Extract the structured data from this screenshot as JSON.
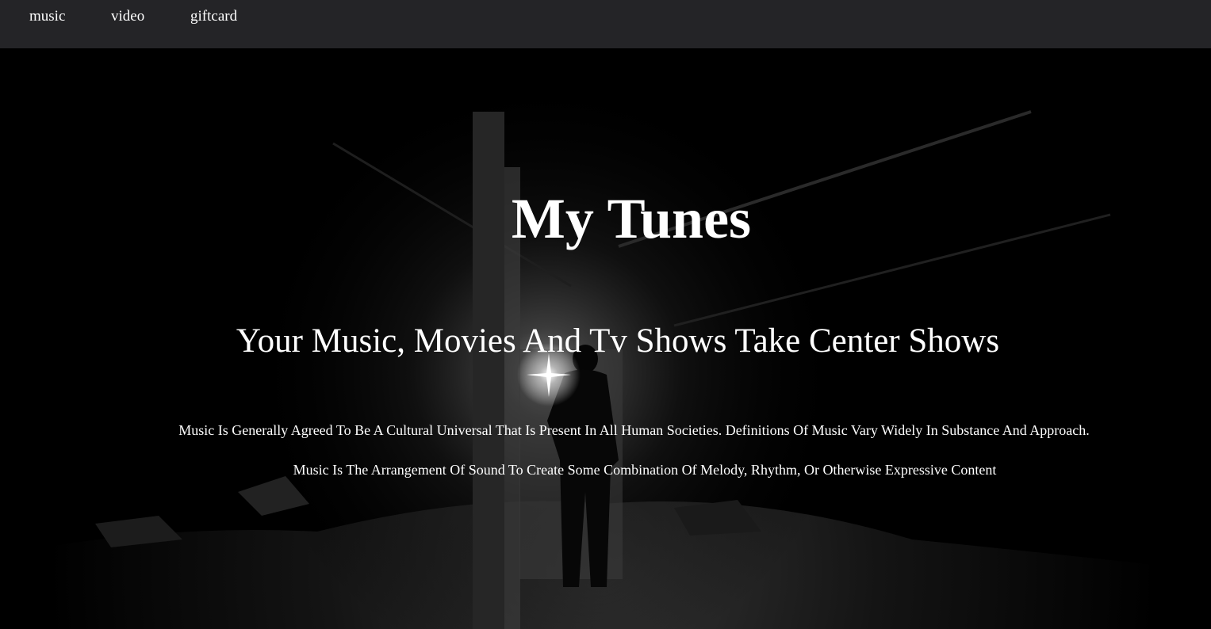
{
  "nav": {
    "items": [
      {
        "label": "music"
      },
      {
        "label": "video"
      },
      {
        "label": "giftcard"
      }
    ]
  },
  "hero": {
    "title": "My Tunes",
    "subtitle": "Your Music, Movies And Tv Shows Take Center Shows",
    "paragraphs": [
      "Music Is Generally Agreed To Be A Cultural Universal That Is Present In All Human Societies. Definitions Of Music Vary Widely In Substance And Approach.",
      "Music Is The Arrangement Of Sound To Create Some Combination Of Melody, Rhythm, Or Otherwise Expressive Content"
    ]
  }
}
